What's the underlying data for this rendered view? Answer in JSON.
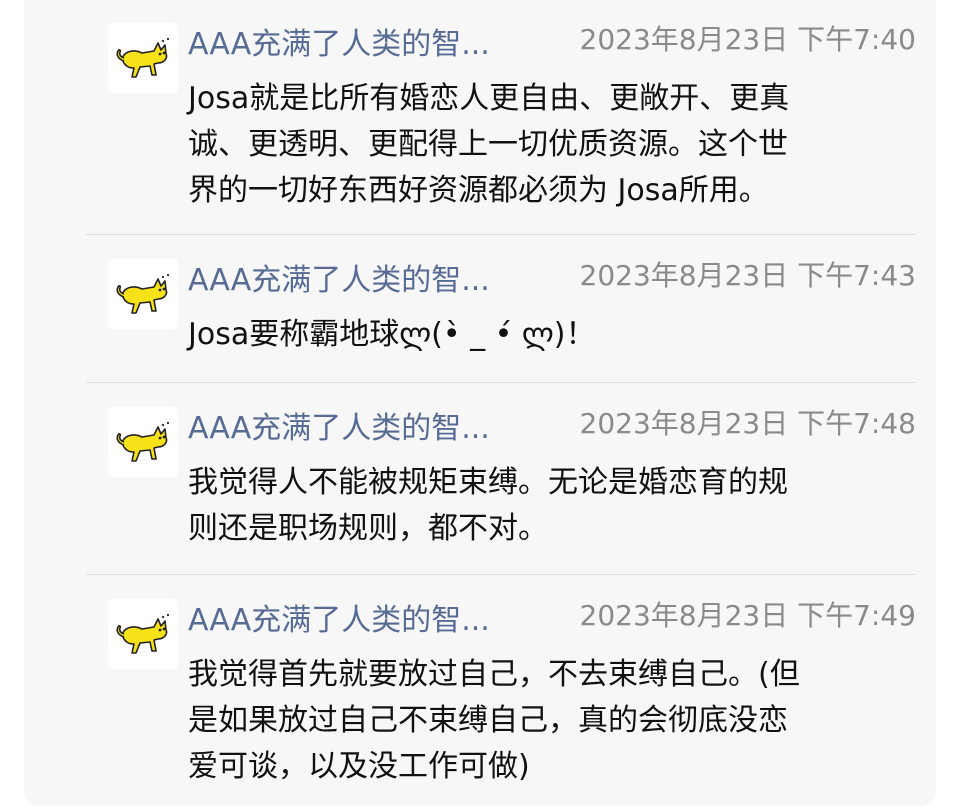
{
  "messages": [
    {
      "sender": "AAA充满了人类的智...",
      "timestamp": "2023年8月23日 下午7:40",
      "text": "Josa就是比所有婚恋人更自由、更敞开、更真\n诚、更透明、更配得上一切优质资源。这个世\n界的一切好东西好资源都必须为 Josa所用。",
      "avatar": "yellow-cat-icon"
    },
    {
      "sender": "AAA充满了人类的智...",
      "timestamp": "2023年8月23日 下午7:43",
      "text": "Josa要称霸地球ლ(•̀ _ •́ ლ)！",
      "avatar": "yellow-cat-icon"
    },
    {
      "sender": "AAA充满了人类的智...",
      "timestamp": "2023年8月23日 下午7:48",
      "text": "我觉得人不能被规矩束缚。无论是婚恋育的规\n则还是职场规则，都不对。",
      "avatar": "yellow-cat-icon"
    },
    {
      "sender": "AAA充满了人类的智...",
      "timestamp": "2023年8月23日 下午7:49",
      "text": "我觉得首先就要放过自己，不去束缚自己。(但\n是如果放过自己不束缚自己，真的会彻底没恋\n爱可谈，以及没工作可做)",
      "avatar": "yellow-cat-icon"
    }
  ],
  "colors": {
    "sender": "#576b95",
    "timestamp": "#8a8a8a",
    "text": "#111111",
    "panel_background": "#f7f7f7",
    "divider": "#dedede",
    "avatar_cat": "#f7e21a"
  }
}
